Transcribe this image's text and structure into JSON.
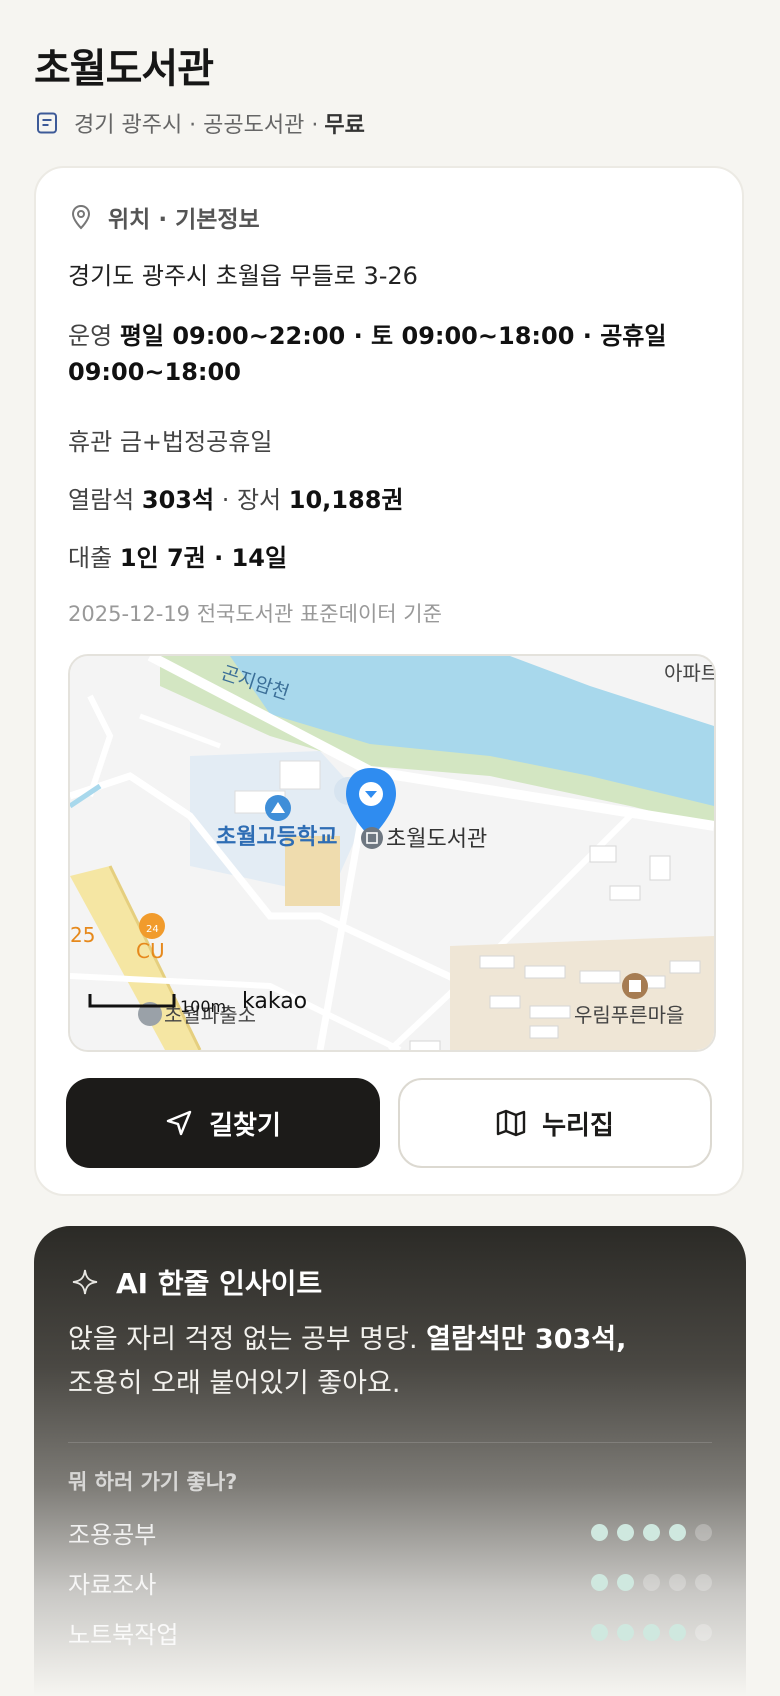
{
  "header": {
    "title": "초월도서관",
    "meta": "경기 광주시 · 공공도서관 ·",
    "fee": "무료"
  },
  "info": {
    "section_title": "위치 · 기본정보",
    "address": "경기도 광주시 초월읍 무들로 3-26",
    "hours_label": "운영",
    "hours_line1": "평일 09:00~22:00 · 토 09:00~18:00 · 공휴일",
    "hours_line2": "09:00~18:00",
    "closed_label": "휴관",
    "closed_value": "금+법정공휴일",
    "seats_label": "열람석",
    "seats_value": "303석",
    "books_label": "· 장서",
    "books_value": "10,188권",
    "loan_label": "대출",
    "loan_value": "1인 7권 · 14일",
    "source": "2025-12-19 전국도서관 표준데이터 기준"
  },
  "map": {
    "labels": {
      "library": "초월도서관",
      "school": "초월고등학교",
      "stream": "곤지암천",
      "apt": "아파트",
      "village": "우림푸른마을",
      "store": "CU",
      "store_hours": "24",
      "road_num": "25",
      "police": "초월파출소",
      "scale": "100m",
      "brand": "kakao"
    },
    "colors": {
      "water": "#a8d8ec",
      "park": "#d3e6c2",
      "pin": "#2f8cf0",
      "road": "#ffffff",
      "main_road": "#f5e6a3"
    }
  },
  "actions": {
    "directions": "길찾기",
    "nurizip": "누리집"
  },
  "ai": {
    "title": "AI 한줄 인사이트",
    "text_plain": "앉을 자리 걱정 없는 공부 명당.",
    "text_bold": "열람석만 303석,",
    "text_line2": "조용히 오래 붙어있기 좋아요.",
    "question": "뭐 하러 가기 좋나?",
    "ratings": [
      {
        "label": "조용공부",
        "score": 4,
        "max": 5
      },
      {
        "label": "자료조사",
        "score": 2,
        "max": 5
      },
      {
        "label": "노트북작업",
        "score": 4,
        "max": 5
      }
    ]
  }
}
